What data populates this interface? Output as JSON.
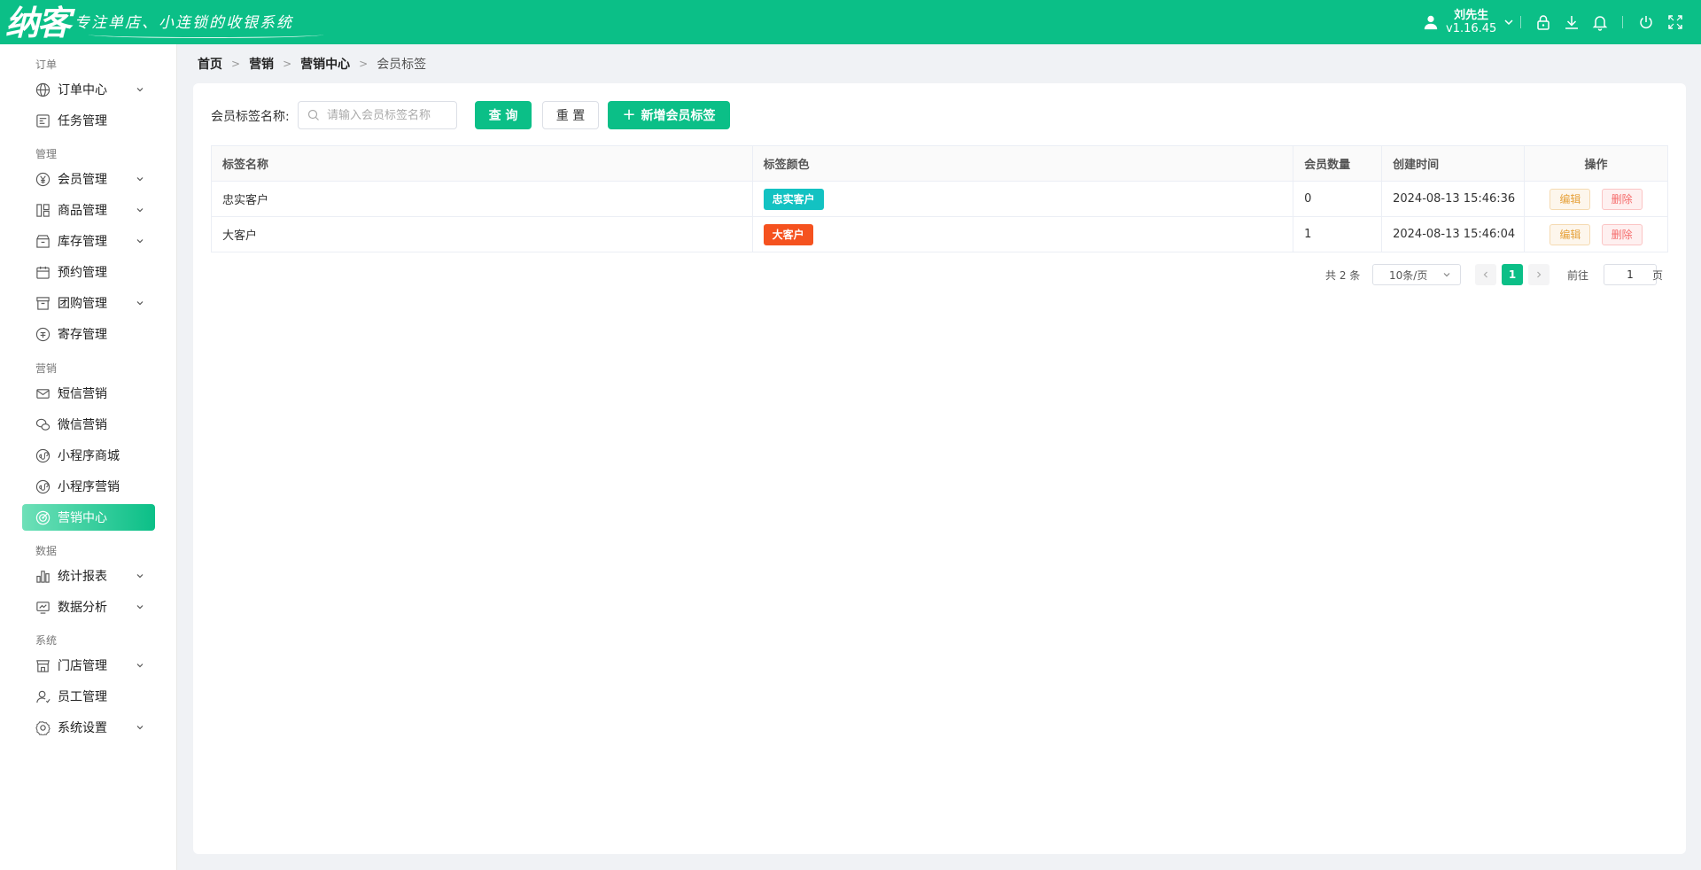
{
  "header": {
    "logo_main": "纳客",
    "logo_slogan": "专注单店、小连锁的收银系统",
    "user_name": "刘先生",
    "version": "v1.16.45"
  },
  "sidebar": {
    "groups": [
      {
        "label": "订单"
      },
      {
        "label": "管理"
      },
      {
        "label": "营销"
      },
      {
        "label": "数据"
      },
      {
        "label": "系统"
      }
    ],
    "items": [
      {
        "label": "订单中心",
        "icon": "globe-icon",
        "has_children": true
      },
      {
        "label": "任务管理",
        "icon": "task-icon",
        "has_children": false
      },
      {
        "label": "会员管理",
        "icon": "yen-icon",
        "has_children": true
      },
      {
        "label": "商品管理",
        "icon": "product-icon",
        "has_children": true
      },
      {
        "label": "库存管理",
        "icon": "inventory-icon",
        "has_children": true
      },
      {
        "label": "预约管理",
        "icon": "calendar-icon",
        "has_children": false
      },
      {
        "label": "团购管理",
        "icon": "groupbuy-icon",
        "has_children": true
      },
      {
        "label": "寄存管理",
        "icon": "deposit-icon",
        "has_children": false
      },
      {
        "label": "短信营销",
        "icon": "mail-icon",
        "has_children": false
      },
      {
        "label": "微信营销",
        "icon": "wechat-icon",
        "has_children": false
      },
      {
        "label": "小程序商城",
        "icon": "miniprogram-icon",
        "has_children": false
      },
      {
        "label": "小程序营销",
        "icon": "miniprogram-icon",
        "has_children": false
      },
      {
        "label": "营销中心",
        "icon": "target-icon",
        "has_children": false,
        "active": true
      },
      {
        "label": "统计报表",
        "icon": "bar-chart-icon",
        "has_children": true
      },
      {
        "label": "数据分析",
        "icon": "monitor-chart-icon",
        "has_children": true
      },
      {
        "label": "门店管理",
        "icon": "store-icon",
        "has_children": true
      },
      {
        "label": "员工管理",
        "icon": "user-icon",
        "has_children": false
      },
      {
        "label": "系统设置",
        "icon": "gear-icon",
        "has_children": true
      }
    ]
  },
  "breadcrumb": [
    "首页",
    "营销",
    "营销中心",
    "会员标签"
  ],
  "search": {
    "label": "会员标签名称:",
    "placeholder": "请输入会员标签名称",
    "value": "",
    "query_label": "查 询",
    "reset_label": "重 置",
    "add_label": "新增会员标签"
  },
  "table": {
    "columns": [
      "标签名称",
      "标签颜色",
      "会员数量",
      "创建时间",
      "操作"
    ],
    "rows": [
      {
        "name": "忠实客户",
        "tag_text": "忠实客户",
        "tag_color": "#13c2c2",
        "count": "0",
        "created": "2024-08-13 15:46:36",
        "edit": "编辑",
        "delete": "删除"
      },
      {
        "name": "大客户",
        "tag_text": "大客户",
        "tag_color": "#f5521f",
        "count": "1",
        "created": "2024-08-13 15:46:04",
        "edit": "编辑",
        "delete": "删除"
      }
    ]
  },
  "pagination": {
    "total_text": "共 2 条",
    "page_size": "10条/页",
    "current_page": "1",
    "goto_label": "前往",
    "goto_value": "1",
    "page_suffix": "页"
  },
  "colors": {
    "primary": "#0bbf87",
    "tag_loyal": "#13c2c2",
    "tag_big": "#f5521f"
  }
}
